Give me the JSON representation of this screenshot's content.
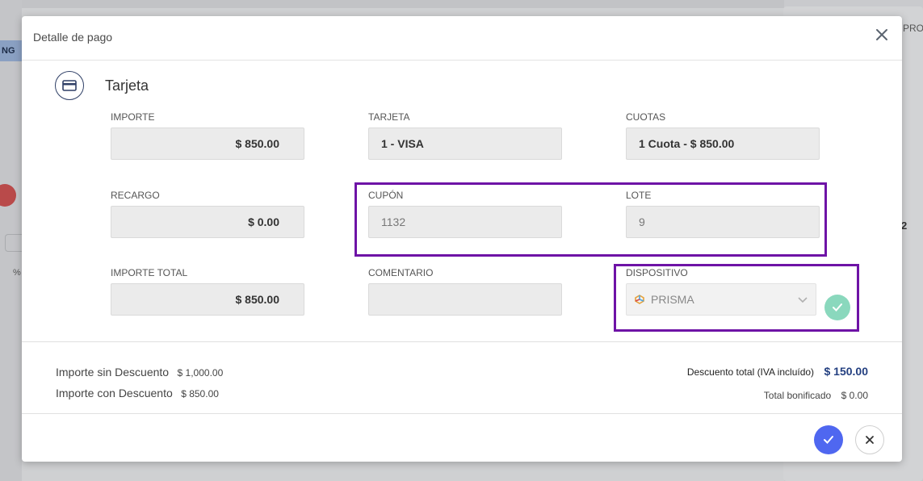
{
  "background": {
    "left_tag": "NG",
    "right_tab": "PRO",
    "right_value": "2",
    "left_pct": "%"
  },
  "modal": {
    "title": "Detalle de pago",
    "section_title": "Tarjeta",
    "fields": {
      "importe": {
        "label": "IMPORTE",
        "value": "$ 850.00"
      },
      "tarjeta": {
        "label": "TARJETA",
        "value": "1 - VISA"
      },
      "cuotas": {
        "label": "CUOTAS",
        "value": "1 Cuota - $ 850.00"
      },
      "recargo": {
        "label": "RECARGO",
        "value": "$ 0.00"
      },
      "cupon": {
        "label": "CUPÓN",
        "value": "1132"
      },
      "lote": {
        "label": "LOTE",
        "value": "9"
      },
      "importe_total": {
        "label": "IMPORTE TOTAL",
        "value": "$ 850.00"
      },
      "comentario": {
        "label": "COMENTARIO",
        "value": ""
      },
      "dispositivo": {
        "label": "DISPOSITIVO",
        "value": "PRISMA"
      }
    },
    "summary": {
      "sin_descuento_label": "Importe sin Descuento",
      "sin_descuento_value": "$ 1,000.00",
      "con_descuento_label": "Importe con Descuento",
      "con_descuento_value": "$ 850.00",
      "descuento_total_label": "Descuento total (IVA incluído)",
      "descuento_total_value": "$ 150.00",
      "total_bonificado_label": "Total bonificado",
      "total_bonificado_value": "$ 0.00"
    },
    "colors": {
      "accent": "#4f67f0",
      "highlight": "#6e13a6",
      "success": "#8ad8bd",
      "discount": "#233f80"
    }
  }
}
